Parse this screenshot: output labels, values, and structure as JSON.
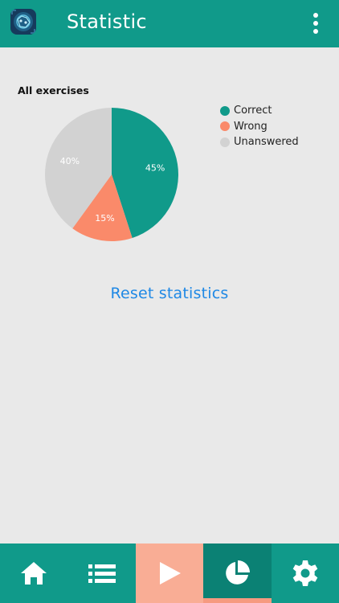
{
  "app": {
    "title": "Statistic",
    "icon": "app-logo-icon"
  },
  "header": {
    "overflow_icon": "more-vert-icon"
  },
  "chart_data": {
    "type": "pie",
    "title": "All exercises",
    "slices": [
      {
        "name": "Correct",
        "value": 45,
        "label": "45%",
        "color": "#109a8a"
      },
      {
        "name": "Wrong",
        "value": 15,
        "label": "15%",
        "color": "#fa8a6a"
      },
      {
        "name": "Unanswered",
        "value": 40,
        "label": "40%",
        "color": "#d2d2d2"
      }
    ],
    "legend_position": "right"
  },
  "actions": {
    "reset_label": "Reset statistics"
  },
  "colors": {
    "primary": "#109a8a",
    "primary_dark": "#0b8174",
    "accent": "#f9ad95",
    "link": "#1e88e5",
    "background": "#e9e9e9"
  },
  "bottom_nav": [
    {
      "id": "home",
      "icon": "home-icon"
    },
    {
      "id": "list",
      "icon": "list-icon"
    },
    {
      "id": "play",
      "icon": "play-icon"
    },
    {
      "id": "statistic",
      "icon": "pie-chart-icon",
      "active": true
    },
    {
      "id": "settings",
      "icon": "gear-icon"
    }
  ]
}
